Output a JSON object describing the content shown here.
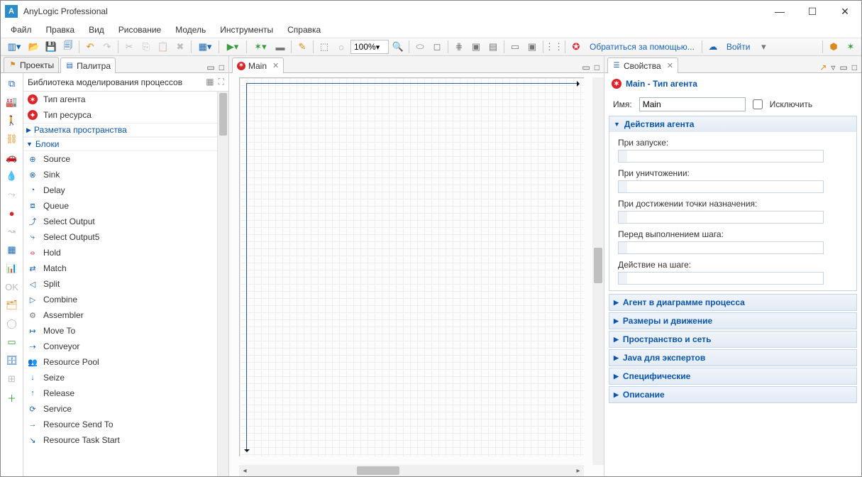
{
  "app": {
    "title": "AnyLogic Professional",
    "icon_letter": "A"
  },
  "menu": [
    "Файл",
    "Правка",
    "Вид",
    "Рисование",
    "Модель",
    "Инструменты",
    "Справка"
  ],
  "toolbar": {
    "zoom": "100%",
    "help_label": "Обратиться за помощью...",
    "login_label": "Войти"
  },
  "left": {
    "tab_projects": "Проекты",
    "tab_palette": "Палитра",
    "library_title": "Библиотека моделирования процессов",
    "items_top": [
      {
        "icon": "●",
        "label": "Тип агента",
        "cls": "bg-red"
      },
      {
        "icon": "●",
        "label": "Тип ресурса",
        "cls": "bg-red"
      }
    ],
    "group_space": "Разметка пространства",
    "group_blocks": "Блоки",
    "blocks": [
      {
        "icon": "⊕",
        "label": "Source",
        "cls": "c-blue"
      },
      {
        "icon": "⊗",
        "label": "Sink",
        "cls": "c-blue"
      },
      {
        "icon": "◔",
        "label": "Delay",
        "cls": "c-blue"
      },
      {
        "icon": "⧈",
        "label": "Queue",
        "cls": "c-blue"
      },
      {
        "icon": "⤴",
        "label": "Select Output",
        "cls": "c-blue"
      },
      {
        "icon": "⤷",
        "label": "Select Output5",
        "cls": "c-blue"
      },
      {
        "icon": "⦵",
        "label": "Hold",
        "cls": "c-red"
      },
      {
        "icon": "⇄",
        "label": "Match",
        "cls": "c-blue"
      },
      {
        "icon": "◁",
        "label": "Split",
        "cls": "c-blue"
      },
      {
        "icon": "▷",
        "label": "Combine",
        "cls": "c-blue"
      },
      {
        "icon": "⚙",
        "label": "Assembler",
        "cls": "c-gray"
      },
      {
        "icon": "↦",
        "label": "Move To",
        "cls": "c-blue"
      },
      {
        "icon": "⇢",
        "label": "Conveyor",
        "cls": "c-blue"
      },
      {
        "icon": "👥",
        "label": "Resource Pool",
        "cls": "c-blue"
      },
      {
        "icon": "↓",
        "label": "Seize",
        "cls": "c-blue"
      },
      {
        "icon": "↑",
        "label": "Release",
        "cls": "c-blue"
      },
      {
        "icon": "⟳",
        "label": "Service",
        "cls": "c-blue"
      },
      {
        "icon": "→",
        "label": "Resource Send To",
        "cls": "c-blue"
      },
      {
        "icon": "↘",
        "label": "Resource Task Start",
        "cls": "c-blue"
      }
    ]
  },
  "center": {
    "tab_main": "Main"
  },
  "right": {
    "tab_props": "Свойства",
    "title": "Main - Тип агента",
    "name_label": "Имя:",
    "name_value": "Main",
    "exclude_label": "Исключить",
    "section_actions": "Действия агента",
    "fields": [
      "При запуске:",
      "При уничтожении:",
      "При достижении точки назначения:",
      "Перед выполнением шага:",
      "Действие на шаге:"
    ],
    "sections_collapsed": [
      "Агент в диаграмме процесса",
      "Размеры и движение",
      "Пространство и сеть",
      "Java для экспертов",
      "Специфические",
      "Описание"
    ]
  }
}
